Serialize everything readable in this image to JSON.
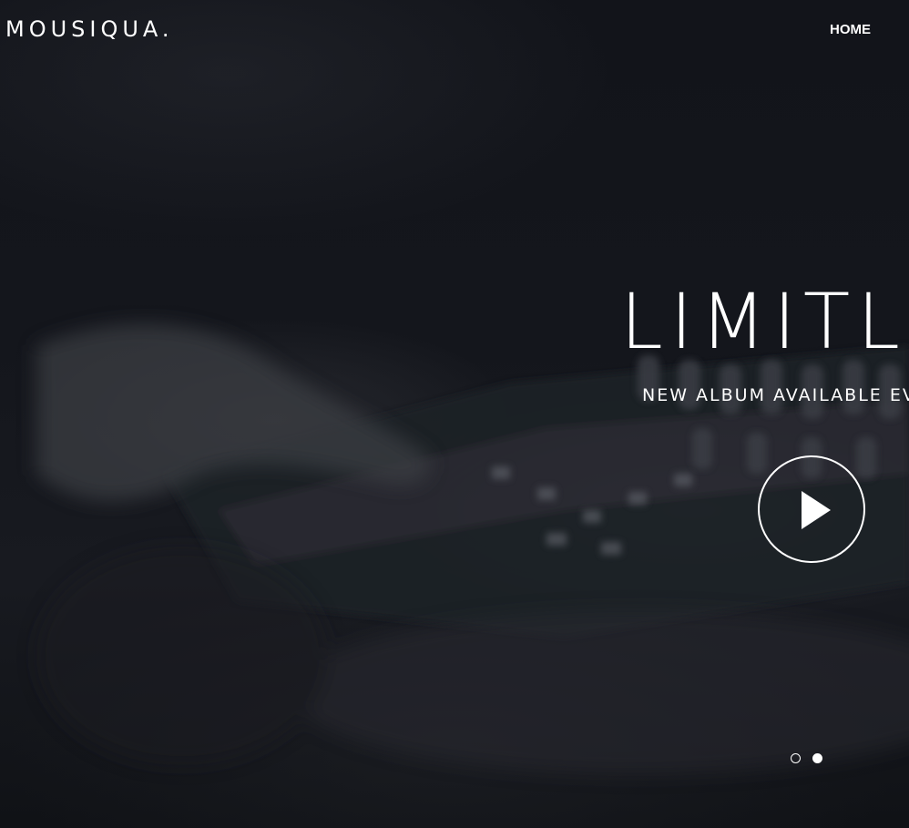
{
  "header": {
    "logo": "MOUSIQUA.",
    "nav": {
      "home_label": "HOME"
    }
  },
  "hero": {
    "headline": "LIMITLESS",
    "subline": "NEW ALBUM AVAILABLE EVERYWHERE",
    "play_button_icon": "play-icon",
    "slides": {
      "count": 2,
      "active_index": 1
    }
  },
  "colors": {
    "background": "#12141a",
    "text": "#ffffff"
  }
}
